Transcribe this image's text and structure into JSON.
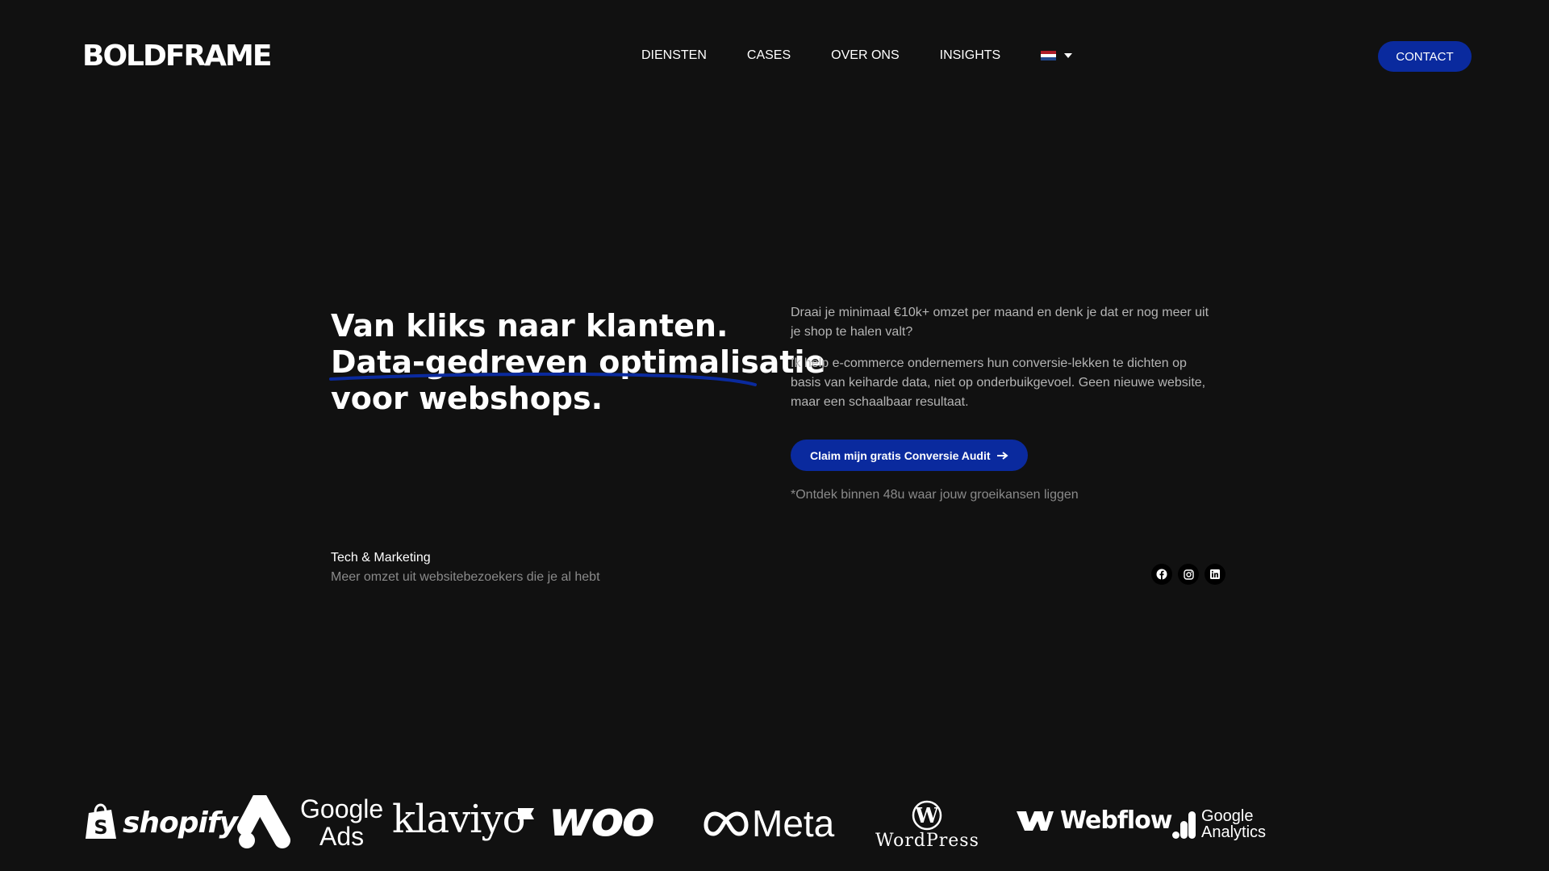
{
  "header": {
    "logo": "BOLDFRAME",
    "nav": [
      "DIENSTEN",
      "CASES",
      "OVER ONS",
      "INSIGHTS"
    ],
    "language_flag_icon": "netherlands-flag-icon",
    "contact_label": "CONTACT"
  },
  "hero": {
    "headline_line1": "Van kliks naar klanten.",
    "headline_line2": "Data-gedreven optimalisatie",
    "headline_line3": "voor webshops.",
    "paragraph1": "Draai je minimaal €10k+ omzet per maand en denk je dat er nog meer uit je shop te halen valt?",
    "paragraph2": "Ik help e-commerce ondernemers hun conversie-lekken te dichten op basis van keiharde data, niet op onderbuikgevoel. Geen nieuwe website, maar een schaalbaar resultaat.",
    "cta_label": "Claim mijn gratis Conversie Audit",
    "note": "*Ontdek binnen 48u waar jouw groeikansen liggen"
  },
  "tagline": {
    "title": "Tech & Marketing",
    "subtitle": "Meer omzet uit websitebezoekers die je al hebt"
  },
  "socials": [
    "facebook-icon",
    "instagram-icon",
    "linkedin-icon"
  ],
  "brands": {
    "shopify": "shopify",
    "google_ads_line1": "Google",
    "google_ads_line2": "Ads",
    "klaviyo": "klaviyo",
    "woo": "woo",
    "meta": "Meta",
    "wordpress": "WordPress",
    "webflow": "Webflow",
    "google_analytics_line1": "Google",
    "google_analytics_line2": "Analytics"
  },
  "colors": {
    "background": "#111111",
    "accent": "#0a2a9e",
    "text_muted": "#b5b5b5"
  }
}
